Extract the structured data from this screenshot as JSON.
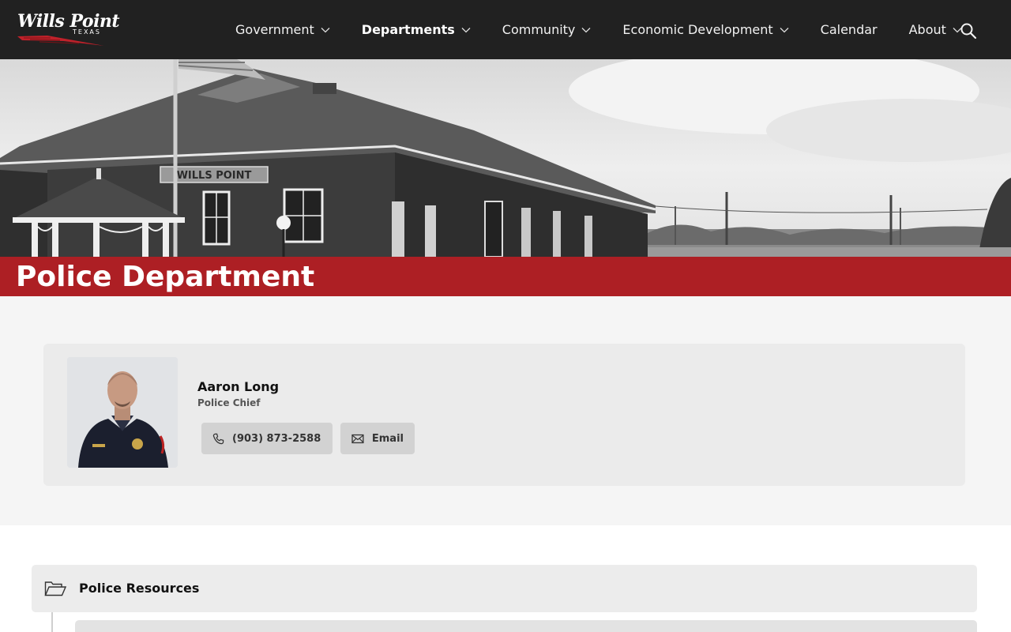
{
  "site": {
    "logo_text": "Wills Point",
    "logo_subtext": "TEXAS"
  },
  "nav": {
    "items": [
      {
        "label": "Government",
        "dropdown": true,
        "active": false
      },
      {
        "label": "Departments",
        "dropdown": true,
        "active": true
      },
      {
        "label": "Community",
        "dropdown": true,
        "active": false
      },
      {
        "label": "Economic Development",
        "dropdown": true,
        "active": false
      },
      {
        "label": "Calendar",
        "dropdown": false,
        "active": false
      },
      {
        "label": "About",
        "dropdown": true,
        "active": false
      }
    ],
    "search_icon": "search-icon"
  },
  "hero": {
    "sign_text": "WILLS POINT"
  },
  "page": {
    "title": "Police Department"
  },
  "staff": {
    "name": "Aaron Long",
    "role": "Police Chief",
    "phone": "(903) 873-2588",
    "email_label": "Email"
  },
  "resources": {
    "title": "Police Resources"
  },
  "colors": {
    "header_bg": "#212121",
    "brand_red": "#ad1f24",
    "section_bg": "#f5f5f5",
    "card_bg": "#ebebeb",
    "button_bg": "#d2d2d2"
  }
}
